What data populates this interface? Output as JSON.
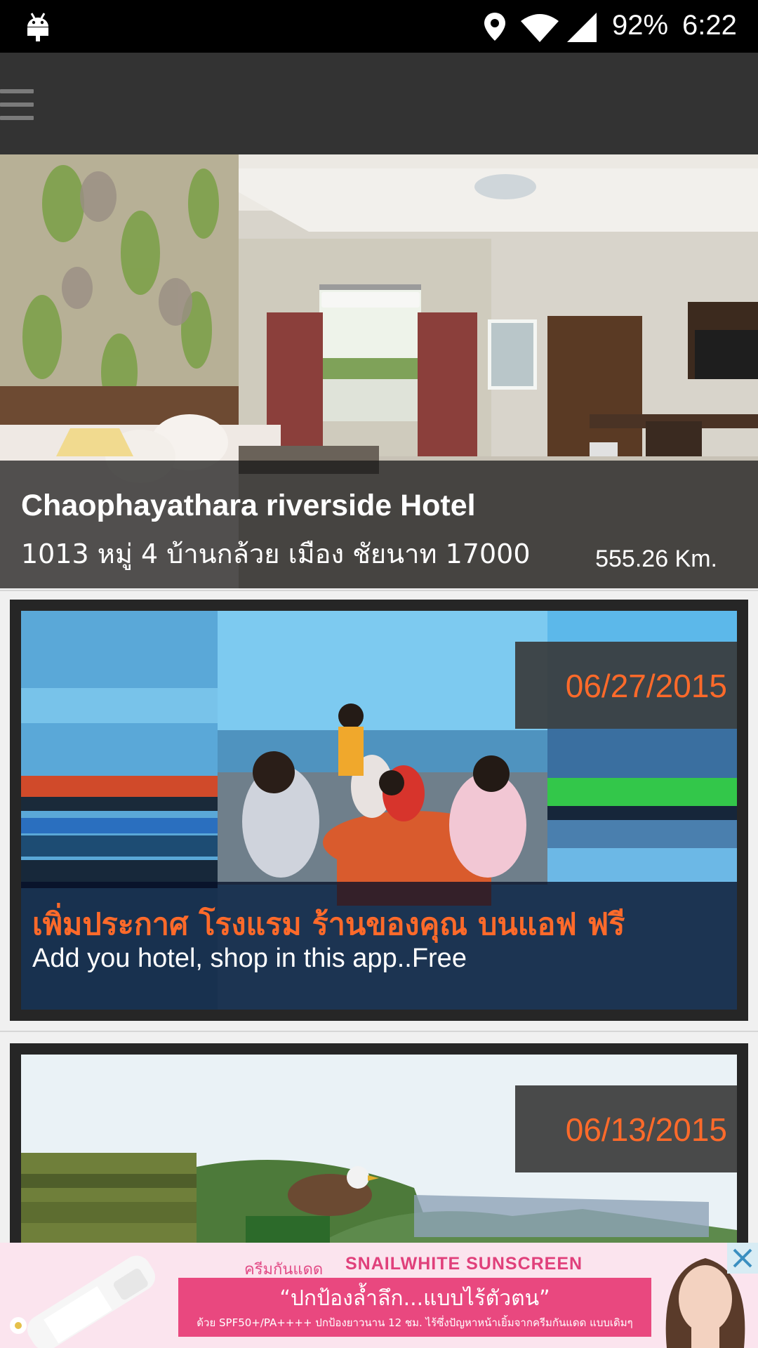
{
  "status_bar": {
    "battery": "92%",
    "time": "6:22",
    "icons": [
      "android-debug-icon",
      "location-icon",
      "wifi-icon",
      "cell-signal-icon"
    ]
  },
  "app_bar": {
    "menu_icon": "hamburger-menu-icon"
  },
  "hero": {
    "title": "Chaophayathara riverside Hotel",
    "address": "1013 หมู่ 4 บ้านกล้วย เมือง ชัยนาท 17000",
    "distance": "555.26 Km."
  },
  "cards": [
    {
      "date": "06/27/2015",
      "title": "เพิ่มประกาศ โรงแรม ร้านของคุณ บนแอฟ ฟรี",
      "subtitle": "Add you hotel, shop in this app..Free"
    },
    {
      "date": "06/13/2015"
    }
  ],
  "ad": {
    "small_text": "ครีมกันแดด",
    "brand": "SNAILWHITE SUNSCREEN",
    "headline": "“ปกป้องล้ำลึก...แบบไร้ตัวตน”",
    "fine_print": "ด้วย SPF50+/PA++++ ปกป้องยาวนาน 12 ชม. ไร้ซึ่งปัญหาหน้าเยิ้มจากครีมกันแดด แบบเดิมๆ",
    "close_icon": "close-icon"
  },
  "colors": {
    "app_bar": "#333333",
    "accent": "#ff6a2a",
    "ad_pink": "#e9487f"
  }
}
